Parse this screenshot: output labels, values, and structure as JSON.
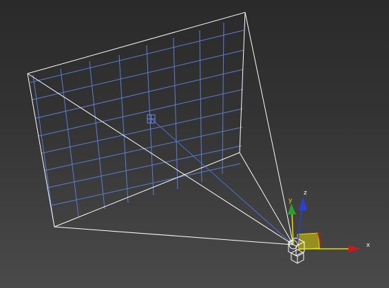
{
  "viewport": {
    "background_top": "#2a2a2a",
    "background_bottom": "#4a4a4a"
  },
  "scene": {
    "frustum_color": "#ffffff",
    "grid_color": "#5a7fd6",
    "camera_object": "free-camera",
    "target_marker": "camera-target-marker"
  },
  "gizmo": {
    "x_label": "x",
    "y_label": "y",
    "z_label": "z",
    "x_color": "#d01818",
    "y_color": "#2aa02a",
    "z_color": "#2a3fd6",
    "plane_color": "#d8d000"
  }
}
